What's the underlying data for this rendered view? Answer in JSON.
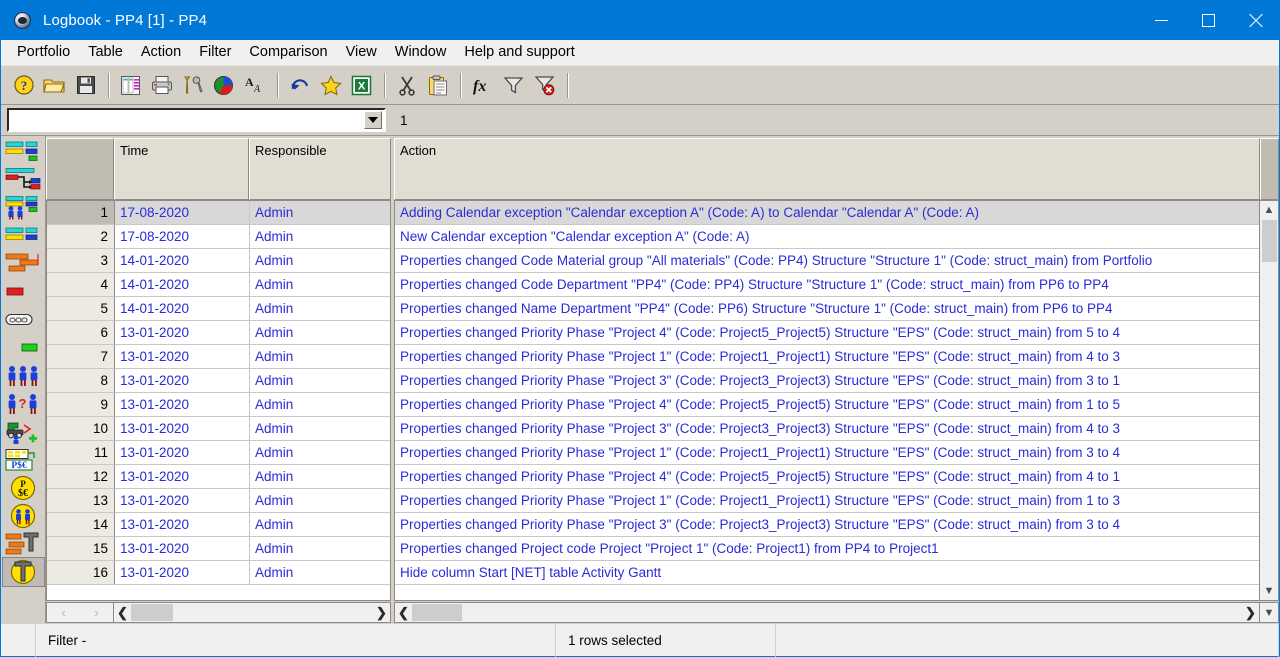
{
  "window": {
    "title": "Logbook - PP4 [1] - PP4",
    "icon": "app-globe-icon",
    "controls": {
      "minimize": "minimize",
      "maximize": "maximize",
      "close": "close"
    }
  },
  "menubar": {
    "items": [
      {
        "label": "Portfolio",
        "name": "menu-portfolio"
      },
      {
        "label": "Table",
        "name": "menu-table"
      },
      {
        "label": "Action",
        "name": "menu-action"
      },
      {
        "label": "Filter",
        "name": "menu-filter"
      },
      {
        "label": "Comparison",
        "name": "menu-comparison"
      },
      {
        "label": "View",
        "name": "menu-view"
      },
      {
        "label": "Window",
        "name": "menu-window"
      },
      {
        "label": "Help and support",
        "name": "menu-help-and-support"
      }
    ]
  },
  "toolbar": {
    "groups": [
      [
        "help-icon",
        "open-folder-icon",
        "save-disk-icon"
      ],
      [
        "table-grid-icon",
        "print-icon",
        "tools-wrench-icon",
        "pie-chart-icon",
        "font-format-icon"
      ],
      [
        "undo-icon",
        "favorite-star-icon",
        "export-excel-icon"
      ],
      [
        "cut-scissors-icon",
        "paste-clipboard-icon"
      ],
      [
        "formula-fx-icon",
        "filter-funnel-icon",
        "remove-filter-icon"
      ]
    ]
  },
  "combo_row": {
    "combo_value": "",
    "combo_placeholder": "",
    "dropdown_icon": "chevron-down-icon",
    "counter_label": "1"
  },
  "iconbar": {
    "items": [
      {
        "name": "sidebar-structure-icon",
        "icon": "bars-colored"
      },
      {
        "name": "sidebar-network-icon",
        "icon": "network-flow"
      },
      {
        "name": "sidebar-resources-icon",
        "icon": "bars-people"
      },
      {
        "name": "sidebar-bars-icon",
        "icon": "bars-plain"
      },
      {
        "name": "sidebar-gantt-icon",
        "icon": "gantt-orange"
      },
      {
        "name": "sidebar-red-bar-icon",
        "icon": "red-bar"
      },
      {
        "name": "sidebar-link-icon",
        "icon": "chain-link"
      },
      {
        "name": "sidebar-green-bar-icon",
        "icon": "green-bar"
      },
      {
        "name": "sidebar-people-icon",
        "icon": "three-people"
      },
      {
        "name": "sidebar-people-question-icon",
        "icon": "people-question"
      },
      {
        "name": "sidebar-machine-person-icon",
        "icon": "machine-person-plus"
      },
      {
        "name": "sidebar-cost-table-icon",
        "icon": "cost-table"
      },
      {
        "name": "sidebar-currency-coin-icon",
        "icon": "currency-coin"
      },
      {
        "name": "sidebar-people-coin-icon",
        "icon": "people-coin"
      },
      {
        "name": "sidebar-bolt-bars-icon",
        "icon": "bolt-bars"
      },
      {
        "name": "sidebar-bolt-coin-icon",
        "icon": "bolt-coin"
      }
    ]
  },
  "table": {
    "left_columns": [
      {
        "key": "num",
        "label": ""
      },
      {
        "key": "time",
        "label": "Time"
      },
      {
        "key": "resp",
        "label": "Responsible"
      }
    ],
    "right_columns": [
      {
        "key": "action",
        "label": "Action"
      }
    ],
    "selected_row_index": 0,
    "rows": [
      {
        "num": "1",
        "time": "17-08-2020",
        "resp": "Admin",
        "action": "Adding Calendar exception \"Calendar exception A\" (Code: A) to Calendar \"Calendar A\" (Code: A)"
      },
      {
        "num": "2",
        "time": "17-08-2020",
        "resp": "Admin",
        "action": "New Calendar exception \"Calendar exception A\" (Code: A)"
      },
      {
        "num": "3",
        "time": "14-01-2020",
        "resp": "Admin",
        "action": "Properties changed Code Material group \"All materials\" (Code: PP4) Structure \"Structure 1\" (Code: struct_main) from Portfolio"
      },
      {
        "num": "4",
        "time": "14-01-2020",
        "resp": "Admin",
        "action": "Properties changed Code Department \"PP4\" (Code: PP4) Structure \"Structure 1\" (Code: struct_main) from PP6 to PP4"
      },
      {
        "num": "5",
        "time": "14-01-2020",
        "resp": "Admin",
        "action": "Properties changed Name Department \"PP4\" (Code: PP6) Structure \"Structure 1\" (Code: struct_main) from PP6 to PP4"
      },
      {
        "num": "6",
        "time": "13-01-2020",
        "resp": "Admin",
        "action": "Properties changed Priority Phase \"Project 4\" (Code: Project5_Project5) Structure \"EPS\" (Code: struct_main) from 5 to 4"
      },
      {
        "num": "7",
        "time": "13-01-2020",
        "resp": "Admin",
        "action": "Properties changed Priority Phase \"Project 1\" (Code: Project1_Project1) Structure \"EPS\" (Code: struct_main) from 4 to 3"
      },
      {
        "num": "8",
        "time": "13-01-2020",
        "resp": "Admin",
        "action": "Properties changed Priority Phase \"Project 3\" (Code: Project3_Project3) Structure \"EPS\" (Code: struct_main) from 3 to 1"
      },
      {
        "num": "9",
        "time": "13-01-2020",
        "resp": "Admin",
        "action": "Properties changed Priority Phase \"Project 4\" (Code: Project5_Project5) Structure \"EPS\" (Code: struct_main) from 1 to 5"
      },
      {
        "num": "10",
        "time": "13-01-2020",
        "resp": "Admin",
        "action": "Properties changed Priority Phase \"Project 3\" (Code: Project3_Project3) Structure \"EPS\" (Code: struct_main) from 4 to 3"
      },
      {
        "num": "11",
        "time": "13-01-2020",
        "resp": "Admin",
        "action": "Properties changed Priority Phase \"Project 1\" (Code: Project1_Project1) Structure \"EPS\" (Code: struct_main) from 3 to 4"
      },
      {
        "num": "12",
        "time": "13-01-2020",
        "resp": "Admin",
        "action": "Properties changed Priority Phase \"Project 4\" (Code: Project5_Project5) Structure \"EPS\" (Code: struct_main) from 4 to 1"
      },
      {
        "num": "13",
        "time": "13-01-2020",
        "resp": "Admin",
        "action": "Properties changed Priority Phase \"Project 1\" (Code: Project1_Project1) Structure \"EPS\" (Code: struct_main) from 1 to 3"
      },
      {
        "num": "14",
        "time": "13-01-2020",
        "resp": "Admin",
        "action": "Properties changed Priority Phase \"Project 3\" (Code: Project3_Project3) Structure \"EPS\" (Code: struct_main) from 3 to 4"
      },
      {
        "num": "15",
        "time": "13-01-2020",
        "resp": "Admin",
        "action": "Properties changed Project code Project \"Project 1\" (Code: Project1) from PP4 to Project1"
      },
      {
        "num": "16",
        "time": "13-01-2020",
        "resp": "Admin",
        "action": "Hide column Start [NET] table Activity Gantt"
      }
    ]
  },
  "scrollbars": {
    "left_prev_icon": "chevron-left-icon",
    "left_next_icon": "chevron-right-icon",
    "right_prev_icon": "chevron-left-icon",
    "right_next_icon": "chevron-right-icon",
    "vert_up_icon": "chevron-up-icon",
    "vert_down_icon": "chevron-down-icon"
  },
  "statusbar": {
    "filter": "Filter -",
    "rows_selected": "1 rows selected",
    "extra": ""
  },
  "colors": {
    "titlebar": "#0078d7",
    "chrome": "#d4d0c8",
    "menu_bg": "#f0f0f0",
    "row_text": "#2b2bd8",
    "selection": "#d8d8d8",
    "header_bg": "#e0ddd3"
  }
}
